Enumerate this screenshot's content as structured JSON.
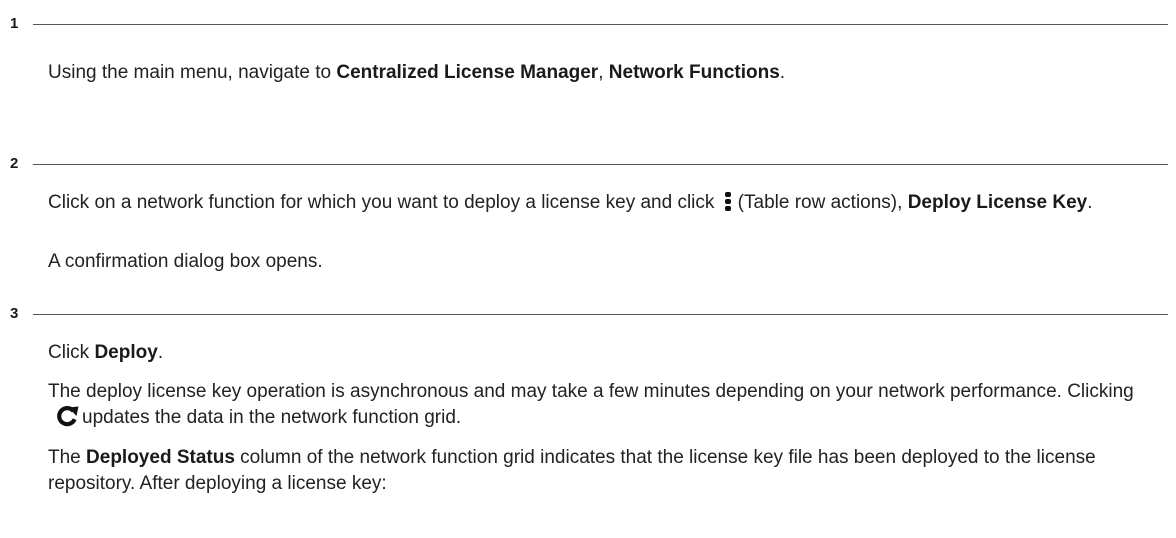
{
  "steps": [
    {
      "number": "1",
      "p1": {
        "t1": "Using the main menu, navigate to ",
        "b1": "Centralized License Manager",
        "t2": ", ",
        "b2": "Network Functions",
        "t3": "."
      }
    },
    {
      "number": "2",
      "p1": {
        "t1": "Click on a network function for which you want to deploy a license key and click ",
        "t2": "(Table row actions), ",
        "b1": "Deploy License Key",
        "t3": "."
      },
      "p2": "A confirmation dialog box opens."
    },
    {
      "number": "3",
      "p1": {
        "t1": "Click ",
        "b1": "Deploy",
        "t2": "."
      },
      "p2": {
        "t1": "The deploy license key operation is asynchronous and may take a few minutes depending on your network performance. Clicking ",
        "t2": "updates the data in the network function grid."
      },
      "p3": {
        "t1": "The ",
        "b1": "Deployed Status",
        "t2": " column of the network function grid indicates that the license key file has been deployed to the license repository. After deploying a license key:"
      }
    }
  ],
  "icons": {
    "kebab": "table-row-actions-icon",
    "refresh": "refresh-icon"
  }
}
